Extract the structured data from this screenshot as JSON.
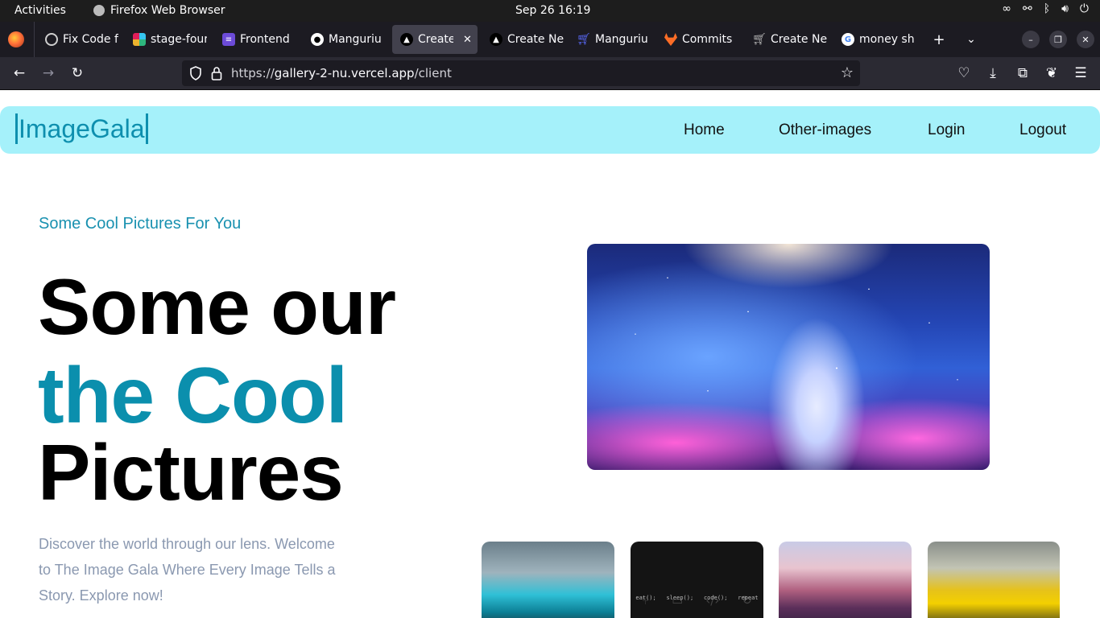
{
  "system": {
    "activities": "Activities",
    "app_name": "Firefox Web Browser",
    "clock": "Sep 26  16:19"
  },
  "browser": {
    "tabs": [
      {
        "label": "Fix Code f",
        "icon": "openai-icon",
        "color": "#10a37f"
      },
      {
        "label": "stage-four",
        "icon": "slack-icon",
        "color": "#e01e5a"
      },
      {
        "label": "Frontend",
        "icon": "notion-page-icon",
        "color": "#6c4bd8"
      },
      {
        "label": "Manguriu",
        "icon": "github-icon",
        "color": "#ffffff"
      },
      {
        "label": "Create N",
        "icon": "vercel-icon",
        "color": "#ffffff"
      },
      {
        "label": "Create Ne",
        "icon": "vercel-icon",
        "color": "#ffffff"
      },
      {
        "label": "Manguriu",
        "icon": "cart-icon",
        "color": "#5b6cff"
      },
      {
        "label": "Commits",
        "icon": "gitlab-icon",
        "color": "#fc6d26"
      },
      {
        "label": "Create Ne",
        "icon": "cart-icon",
        "color": "#bbbbbb"
      },
      {
        "label": "money sh",
        "icon": "google-icon",
        "color": "#4285f4"
      }
    ],
    "url_prefix": "https://",
    "url_host": "gallery-2-nu.vercel.app",
    "url_path": "/client"
  },
  "page": {
    "logo": "ImageGala",
    "nav": {
      "home": "Home",
      "other_images": "Other-images",
      "login": "Login",
      "logout": "Logout"
    },
    "tagline": "Some Cool Pictures For You",
    "hero_line1": "Some our",
    "hero_line2": "the Cool",
    "hero_line3": "Pictures",
    "description": "Discover the world through our lens. Welcome to The Image Gala Where Every Image Tells a Story. Explore now!",
    "thumb_code": [
      "eat();",
      "sleep();",
      "code();",
      "repeat"
    ],
    "colors": {
      "header_bg": "#a5f1fa",
      "accent": "#0b8fad",
      "description": "#8a98b0"
    }
  }
}
